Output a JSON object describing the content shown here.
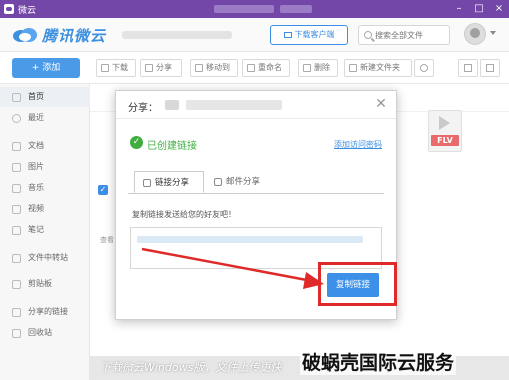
{
  "window": {
    "title": "微云"
  },
  "header": {
    "logo_text": "腾讯微云",
    "download_button": "下载客户端",
    "search_placeholder": "搜索全部文件"
  },
  "toolbar": {
    "add_label": "+ 添加",
    "buttons": [
      "下载",
      "分享",
      "移动到",
      "重命名",
      "删除",
      "新建文件夹"
    ]
  },
  "sidebar": {
    "items": [
      "首页",
      "最近",
      "文档",
      "图片",
      "音乐",
      "视频",
      "笔记",
      "文件中转站",
      "剪贴板",
      "分享的链接",
      "回收站"
    ]
  },
  "main": {
    "file_label": "查看",
    "flv_label": "FLV"
  },
  "dialog": {
    "title": "分享：",
    "success_text": "已创建链接",
    "password_link": "添加访问密码",
    "tab_link": "链接分享",
    "tab_mail": "邮件分享",
    "copy_hint": "复制链接发送给您的好友吧！",
    "copy_button": "复制链接"
  },
  "footer": {
    "text": "下载微云Windows版，文件上传更快"
  },
  "watermark": "破蜗壳国际云服务",
  "colors": {
    "titlebar": "#7347a8",
    "accent": "#3d90e8",
    "success": "#3fae3f",
    "highlight": "#e02a2a"
  }
}
